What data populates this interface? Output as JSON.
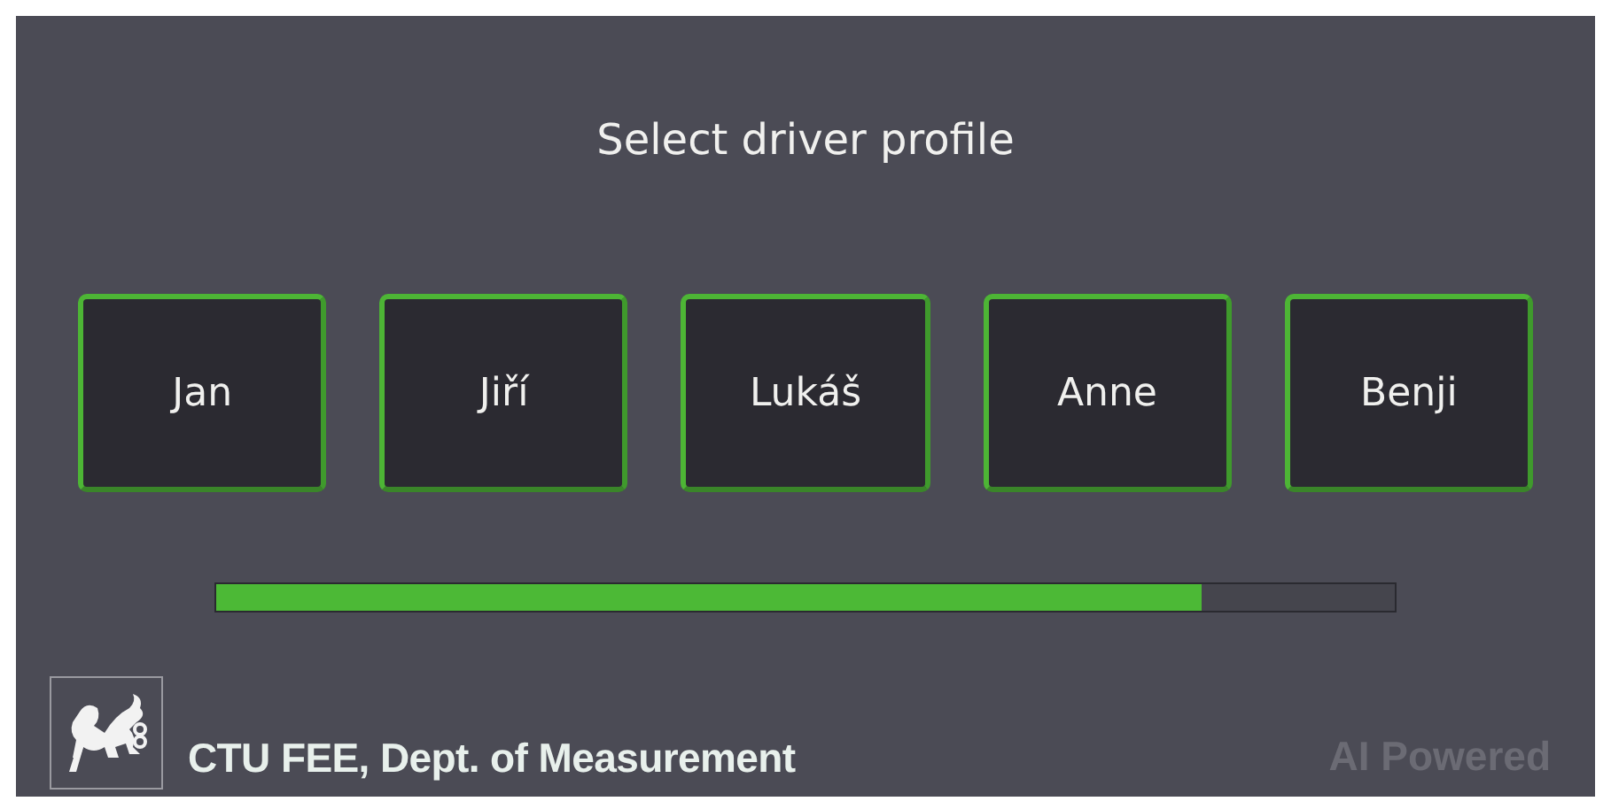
{
  "title": "Select driver profile",
  "profiles": [
    {
      "label": "Jan"
    },
    {
      "label": "Jiří"
    },
    {
      "label": "Lukáš"
    },
    {
      "label": "Anne"
    },
    {
      "label": "Benji"
    }
  ],
  "progress": {
    "level": 0.836
  },
  "footer": {
    "institution": "CTU FEE, Dept. of Measurement",
    "badge": "AI Powered"
  }
}
